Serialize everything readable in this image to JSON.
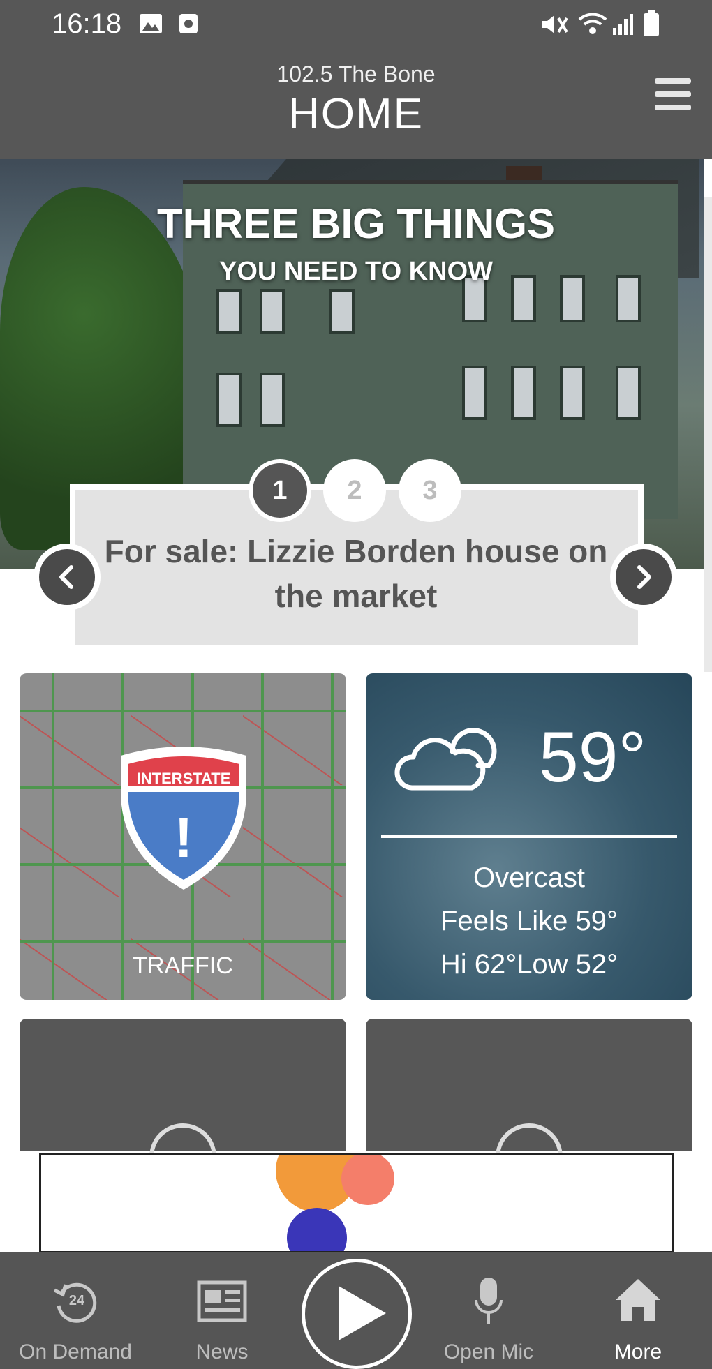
{
  "status_bar": {
    "time": "16:18"
  },
  "header": {
    "station": "102.5 The Bone",
    "title": "HOME"
  },
  "hero": {
    "title": "THREE BIG THINGS",
    "subtitle": "YOU NEED TO KNOW",
    "pages": [
      "1",
      "2",
      "3"
    ],
    "active_page": 1,
    "story": "For sale: Lizzie Borden house on the market"
  },
  "traffic": {
    "label": "TRAFFIC",
    "sign_text": "INTERSTATE",
    "sign_symbol": "!"
  },
  "weather": {
    "temperature": "59°",
    "condition": "Overcast",
    "feels_like": "Feels Like 59°",
    "hi_low": "Hi 62°Low 52°"
  },
  "nav": {
    "on_demand": "On Demand",
    "on_demand_badge": "24",
    "news": "News",
    "open_mic": "Open Mic",
    "more": "More"
  },
  "colors": {
    "header_bg": "#575757",
    "nav_bg": "#555555",
    "sign_red": "#e0414b",
    "sign_blue": "#4a7cc7"
  }
}
